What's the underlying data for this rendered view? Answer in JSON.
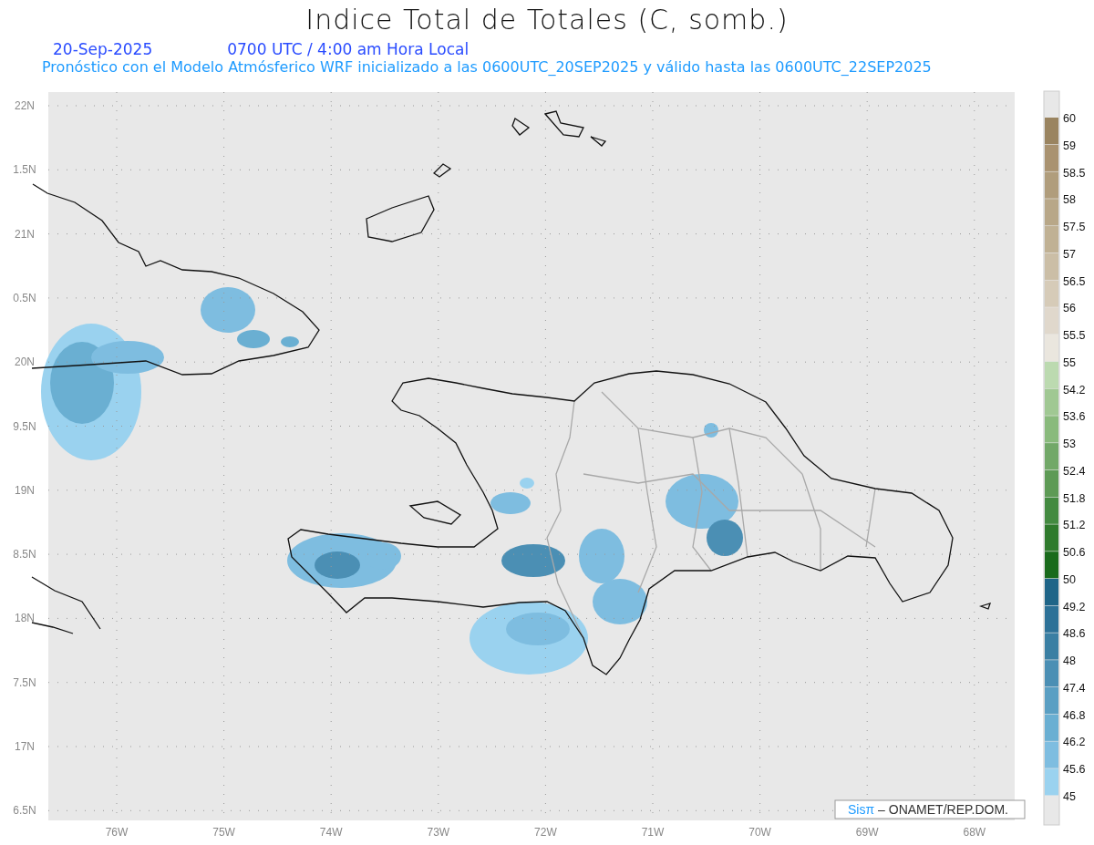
{
  "title": "Indice Total de Totales (C, somb.)",
  "date": "20-Sep-2025",
  "time_label": "0700 UTC / 4:00 am Hora Local",
  "subtitle": "Pronóstico con el Modelo Atmósferico WRF inicializado a las 0600UTC_20SEP2025 y válido hasta las  0600UTC_22SEP2025",
  "map": {
    "lat_labels": [
      "22N",
      "1.5N",
      "21N",
      "0.5N",
      "20N",
      "9.5N",
      "19N",
      "8.5N",
      "18N",
      "7.5N",
      "17N",
      "6.5N"
    ],
    "lon_labels": [
      "76W",
      "75W",
      "74W",
      "73W",
      "72W",
      "71W",
      "70W",
      "69W",
      "68W"
    ],
    "credit": {
      "brand": "Sisπ",
      "text": "– ONAMET/REP.DOM."
    }
  },
  "legend": {
    "labels": [
      "60",
      "59",
      "58.5",
      "58",
      "57.5",
      "57",
      "56.5",
      "56",
      "55.5",
      "55",
      "54.2",
      "53.6",
      "53",
      "52.4",
      "51.8",
      "51.2",
      "50.6",
      "50",
      "49.2",
      "48.6",
      "48",
      "47.4",
      "46.8",
      "46.2",
      "45.6",
      "45"
    ],
    "bins": [
      {
        "color": "#9a8460"
      },
      {
        "color": "#a99270"
      },
      {
        "color": "#b09d7c"
      },
      {
        "color": "#b8a788"
      },
      {
        "color": "#c0b194"
      },
      {
        "color": "#cbbea6"
      },
      {
        "color": "#d6cbb8"
      },
      {
        "color": "#e0d8cc"
      },
      {
        "color": "#eae6de"
      },
      {
        "color": "#bcdab0"
      },
      {
        "color": "#a0c893"
      },
      {
        "color": "#89ba7c"
      },
      {
        "color": "#72a868"
      },
      {
        "color": "#5d9a55"
      },
      {
        "color": "#438a40"
      },
      {
        "color": "#2f7a2c"
      },
      {
        "color": "#1a6b1c"
      },
      {
        "color": "#1f6588"
      },
      {
        "color": "#2c7197"
      },
      {
        "color": "#3a7fa3"
      },
      {
        "color": "#4b8fb4"
      },
      {
        "color": "#5a9fc3"
      },
      {
        "color": "#6aafd2"
      },
      {
        "color": "#7ebde0"
      },
      {
        "color": "#9ad2ef"
      }
    ]
  }
}
